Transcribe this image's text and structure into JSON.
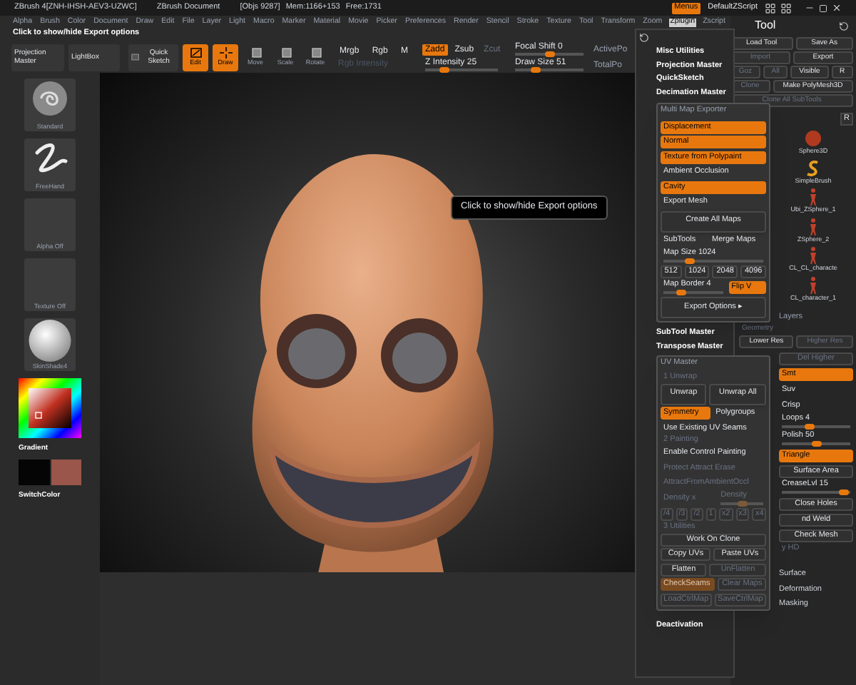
{
  "title_bar": {
    "app": "ZBrush 4[ZNH-IHSH-AEV3-UZWC]",
    "document": "ZBrush Document",
    "objects": "[Objs 9287]",
    "memory": "Mem:1166+153",
    "free": "Free:1731",
    "menus_button": {
      "label": "Menus",
      "on": true
    },
    "script": "DefaultZScript"
  },
  "menu_bar": [
    {
      "label": "Alpha",
      "selected": false
    },
    {
      "label": "Brush",
      "selected": false
    },
    {
      "label": "Color",
      "selected": false
    },
    {
      "label": "Document",
      "selected": false
    },
    {
      "label": "Draw",
      "selected": false
    },
    {
      "label": "Edit",
      "selected": false
    },
    {
      "label": "File",
      "selected": false
    },
    {
      "label": "Layer",
      "selected": false
    },
    {
      "label": "Light",
      "selected": false
    },
    {
      "label": "Macro",
      "selected": false
    },
    {
      "label": "Marker",
      "selected": false
    },
    {
      "label": "Material",
      "selected": false
    },
    {
      "label": "Movie",
      "selected": false
    },
    {
      "label": "Picker",
      "selected": false
    },
    {
      "label": "Preferences",
      "selected": false
    },
    {
      "label": "Render",
      "selected": false
    },
    {
      "label": "Stencil",
      "selected": false
    },
    {
      "label": "Stroke",
      "selected": false
    },
    {
      "label": "Texture",
      "selected": false
    },
    {
      "label": "Tool",
      "selected": false
    },
    {
      "label": "Transform",
      "selected": false
    },
    {
      "label": "Zoom",
      "selected": false
    },
    {
      "label": "Zplugin",
      "selected": true
    },
    {
      "label": "Zscript",
      "selected": false
    }
  ],
  "hint": "Click to show/hide Export options",
  "toolbar": {
    "panels": [
      "Projection Master",
      "LightBox"
    ],
    "quick_sketch": "Quick Sketch",
    "modes": [
      {
        "label": "Edit",
        "kind": "edit",
        "on": true
      },
      {
        "label": "Draw",
        "kind": "draw",
        "on": true
      },
      {
        "label": "Move",
        "kind": "move",
        "on": false
      },
      {
        "label": "Scale",
        "kind": "scale",
        "on": false
      },
      {
        "label": "Rotate",
        "kind": "rotate",
        "on": false
      }
    ],
    "color_modes": [
      {
        "label": "Mrgb",
        "on": false
      },
      {
        "label": "Rgb",
        "on": false
      },
      {
        "label": "M",
        "on": false
      }
    ],
    "rgb_intensity": {
      "label": "Rgb Intensity",
      "disabled": true
    },
    "z_modes": [
      {
        "label": "Zadd",
        "on": true,
        "disabled": false
      },
      {
        "label": "Zsub",
        "on": false,
        "disabled": false
      },
      {
        "label": "Zcut",
        "on": false,
        "disabled": true
      }
    ],
    "sliders": [
      {
        "label": "Z Intensity",
        "value": "25",
        "level": 0.25
      },
      {
        "label": "Focal Shift",
        "value": "0",
        "level": 0.5
      },
      {
        "label": "Draw Size",
        "value": "51",
        "level": 0.3
      }
    ],
    "counters": [
      "ActivePo",
      "TotalPo"
    ]
  },
  "left_shelf": {
    "thumbnails": [
      {
        "label": "Standard",
        "kind": "brush"
      },
      {
        "label": "FreeHand",
        "kind": "stroke"
      },
      {
        "label": "Alpha Off",
        "kind": "empty"
      },
      {
        "label": "Texture Off",
        "kind": "empty"
      },
      {
        "label": "SkinShade4",
        "kind": "material"
      }
    ],
    "gradient": "Gradient",
    "swatches": [
      {
        "color": "#050505"
      },
      {
        "color": "#9a564a"
      }
    ],
    "switch_color": "SwitchColor"
  },
  "canvas": {
    "tooltip": "Click to show/hide Export options"
  },
  "zplugin_menu": {
    "items_top": [
      "Misc Utilities",
      "Projection Master",
      "QuickSketch",
      "Decimation Master"
    ],
    "multi_map_exporter": {
      "title": "Multi Map Exporter",
      "rows": [
        {
          "items": [
            {
              "kind": "toggle",
              "label": "Displacement",
              "on": true
            }
          ]
        },
        {
          "items": [
            {
              "kind": "toggle",
              "label": "Normal",
              "on": true
            }
          ]
        },
        {
          "items": [
            {
              "kind": "toggle",
              "label": "Texture from Polypaint",
              "on": true
            }
          ]
        },
        {
          "items": [
            {
              "kind": "toggle",
              "label": "Ambient Occlusion",
              "on": false
            }
          ]
        },
        {
          "items": [
            {
              "kind": "toggle",
              "label": "Cavity",
              "on": true
            }
          ]
        },
        {
          "items": [
            {
              "kind": "toggle",
              "label": "Export Mesh",
              "on": false
            }
          ]
        },
        {
          "items": [
            {
              "kind": "big",
              "label": "Create All Maps"
            }
          ]
        },
        {
          "items": [
            {
              "kind": "toggle",
              "label": "SubTools",
              "on": false
            },
            {
              "kind": "toggle",
              "label": "Merge Maps",
              "on": false
            }
          ]
        },
        {
          "items": [
            {
              "kind": "slider",
              "label": "Map Size",
              "value": "1024",
              "level": 0.25
            }
          ]
        },
        {
          "items": [
            {
              "kind": "button",
              "label": "512"
            },
            {
              "kind": "button",
              "label": "1024"
            },
            {
              "kind": "button",
              "label": "2048"
            },
            {
              "kind": "button",
              "label": "4096"
            }
          ]
        },
        {
          "items": [
            {
              "kind": "slider",
              "label": "Map Border",
              "value": "4",
              "level": 0.3
            },
            {
              "kind": "toggle",
              "label": "Flip V",
              "on": true
            }
          ]
        },
        {
          "items": [
            {
              "kind": "big",
              "label": "Export Options ▸"
            }
          ]
        }
      ]
    },
    "items_middle": [
      "SubTool Master",
      "Transpose Master"
    ],
    "uv_master": {
      "title": "UV Master",
      "rows": [
        {
          "items": [
            {
              "kind": "header",
              "label": "1 Unwrap"
            }
          ]
        },
        {
          "items": [
            {
              "kind": "big",
              "label": "Unwrap"
            },
            {
              "kind": "big",
              "label": "Unwrap All"
            }
          ]
        },
        {
          "items": [
            {
              "kind": "toggle",
              "label": "Symmetry",
              "on": true
            },
            {
              "kind": "toggle",
              "label": "Polygroups",
              "on": false
            }
          ]
        },
        {
          "items": [
            {
              "kind": "toggle",
              "label": "Use Existing UV Seams",
              "on": false
            }
          ]
        },
        {
          "items": [
            {
              "kind": "header",
              "label": "2 Painting"
            }
          ]
        },
        {
          "items": [
            {
              "kind": "toggle",
              "label": "Enable Control Painting",
              "on": false
            }
          ]
        },
        {
          "items": [
            {
              "kind": "toggle",
              "label": "Protect Attract Erase",
              "on": false,
              "disabled": true
            }
          ]
        },
        {
          "items": [
            {
              "kind": "toggle",
              "label": "AttractFromAmbientOccl",
              "on": false,
              "disabled": true
            }
          ]
        },
        {
          "items": [
            {
              "kind": "toggle",
              "label": "Density x",
              "on": false,
              "disabled": true
            },
            {
              "kind": "slider",
              "label": "Density",
              "level": 0.5,
              "disabled": true
            }
          ]
        },
        {
          "items": [
            {
              "kind": "button",
              "label": "/4",
              "disabled": true
            },
            {
              "kind": "button",
              "label": "/3",
              "disabled": true
            },
            {
              "kind": "button",
              "label": "/2",
              "disabled": true
            },
            {
              "kind": "button",
              "label": "1",
              "disabled": true
            },
            {
              "kind": "button",
              "label": "x2",
              "disabled": true
            },
            {
              "kind": "button",
              "label": "x3",
              "disabled": true
            },
            {
              "kind": "button",
              "label": "x4",
              "disabled": true
            }
          ]
        },
        {
          "items": [
            {
              "kind": "header",
              "label": "3 Utilities"
            }
          ]
        },
        {
          "items": [
            {
              "kind": "button",
              "label": "Work On Clone"
            }
          ]
        },
        {
          "items": [
            {
              "kind": "button",
              "label": "Copy UVs"
            },
            {
              "kind": "button",
              "label": "Paste UVs"
            }
          ]
        },
        {
          "items": [
            {
              "kind": "button",
              "label": "Flatten"
            },
            {
              "kind": "button",
              "label": "UnFlatten",
              "disabled": true
            }
          ]
        },
        {
          "items": [
            {
              "kind": "toggle",
              "label": "CheckSeams",
              "on": true,
              "disabled": true
            },
            {
              "kind": "button",
              "label": "Clear Maps",
              "disabled": true
            }
          ]
        },
        {
          "items": [
            {
              "kind": "button",
              "label": "LoadCtrlMap",
              "disabled": true
            },
            {
              "kind": "button",
              "label": "SaveCtrlMap",
              "disabled": true
            }
          ]
        }
      ]
    },
    "items_bottom": [
      "Deactivation"
    ]
  },
  "tool_palette": {
    "title": "Tool",
    "top": [
      {
        "items": [
          {
            "kind": "button",
            "label": "Load Tool"
          },
          {
            "kind": "button",
            "label": "Save As"
          }
        ]
      },
      {
        "items": [
          {
            "kind": "button",
            "label": "Import",
            "disabled": true
          },
          {
            "kind": "button",
            "label": "Export"
          }
        ]
      },
      {
        "items": [
          {
            "kind": "button",
            "label": "Goz",
            "disabled": true
          },
          {
            "kind": "button",
            "label": "All",
            "disabled": true
          },
          {
            "kind": "button",
            "label": "Visible"
          },
          {
            "kind": "button",
            "label": "R"
          }
        ]
      },
      {
        "items": [
          {
            "kind": "button",
            "label": "Clone",
            "disabled": true
          },
          {
            "kind": "button",
            "label": "Make PolyMesh3D"
          }
        ]
      },
      {
        "items": [
          {
            "kind": "button",
            "label": "Clone All SubTools",
            "disabled": true
          }
        ]
      }
    ],
    "r_button": "R",
    "subtools": [
      {
        "label": "Sphere3D",
        "kind": "sphere"
      },
      {
        "label": "SimpleBrush",
        "kind": "brush"
      },
      {
        "label": "Ubi_ZSphere_1",
        "kind": "figure"
      },
      {
        "label": "ZSphere_2",
        "kind": "figure"
      },
      {
        "label": "CL_CL_characte",
        "kind": "figure"
      },
      {
        "label": "CL_character_1",
        "kind": "figure"
      }
    ],
    "layers": "Layers",
    "geometry": [
      {
        "items": [
          {
            "kind": "header",
            "label": "Geometry"
          }
        ]
      },
      {
        "items": [
          {
            "kind": "button",
            "label": "Lower Res"
          },
          {
            "kind": "button",
            "label": "Higher Res",
            "disabled": true
          }
        ]
      }
    ],
    "lower": [
      {
        "items": [
          {
            "kind": "button",
            "label": "Del Higher",
            "disabled": true
          }
        ]
      },
      {
        "items": [
          {
            "kind": "toggle",
            "label": "Smt",
            "on": true
          }
        ]
      },
      {
        "items": [
          {
            "kind": "toggle",
            "label": "Suv",
            "on": false
          }
        ]
      },
      {
        "items": [
          {
            "kind": "toggle",
            "label": "Crisp",
            "on": false
          }
        ]
      },
      {
        "items": [
          {
            "kind": "slider",
            "label": "Loops",
            "value": "4",
            "level": 0.4
          }
        ]
      },
      {
        "items": [
          {
            "kind": "slider",
            "label": "Polish",
            "value": "50",
            "level": 0.5
          }
        ]
      },
      {
        "items": [
          {
            "kind": "toggle",
            "label": "Triangle",
            "on": true
          }
        ]
      },
      {
        "items": [
          {
            "kind": "button",
            "label": "Surface Area"
          }
        ]
      },
      {
        "items": [
          {
            "kind": "slider",
            "label": "CreaseLvl",
            "value": "15",
            "level": 0.9
          }
        ]
      },
      {
        "items": [
          {
            "kind": "button",
            "label": "Close Holes"
          }
        ]
      },
      {
        "items": [
          {
            "kind": "button",
            "label": "nd Weld"
          }
        ]
      },
      {
        "items": [
          {
            "kind": "button",
            "label": "Check Mesh"
          }
        ]
      },
      {
        "items": [
          {
            "kind": "header",
            "label": "y HD"
          }
        ]
      }
    ],
    "bottom": [
      "Surface",
      "Deformation",
      "Masking"
    ]
  }
}
